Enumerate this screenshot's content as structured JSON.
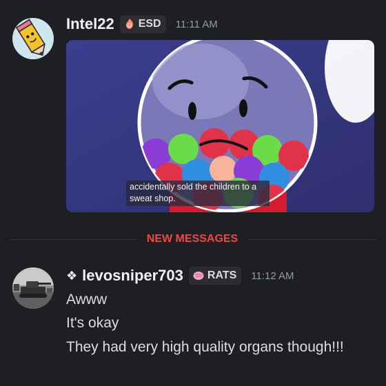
{
  "messages": [
    {
      "username": "Intel22",
      "tag": "ESD",
      "time": "11:11 AM",
      "icons": {
        "avatar": "pencil-character-avatar",
        "tag": "fire-brain-icon"
      },
      "attachment": {
        "type": "video-still",
        "caption": "accidentally sold the children to a sweat shop."
      }
    },
    {
      "prefix": "❖",
      "username": "levosniper703",
      "tag": "RATS",
      "time": "11:12 AM",
      "icons": {
        "avatar": "tank-photo-avatar",
        "tag": "brain-icon"
      },
      "lines": [
        "Awww",
        "It's okay",
        "They had very high quality organs though!!!"
      ]
    }
  ],
  "divider": {
    "label": "NEW MESSAGES"
  },
  "colors": {
    "background": "#1e1f22",
    "new_messages": "#f04747",
    "username": "#f2f3f5",
    "timestamp": "#949ba4"
  }
}
